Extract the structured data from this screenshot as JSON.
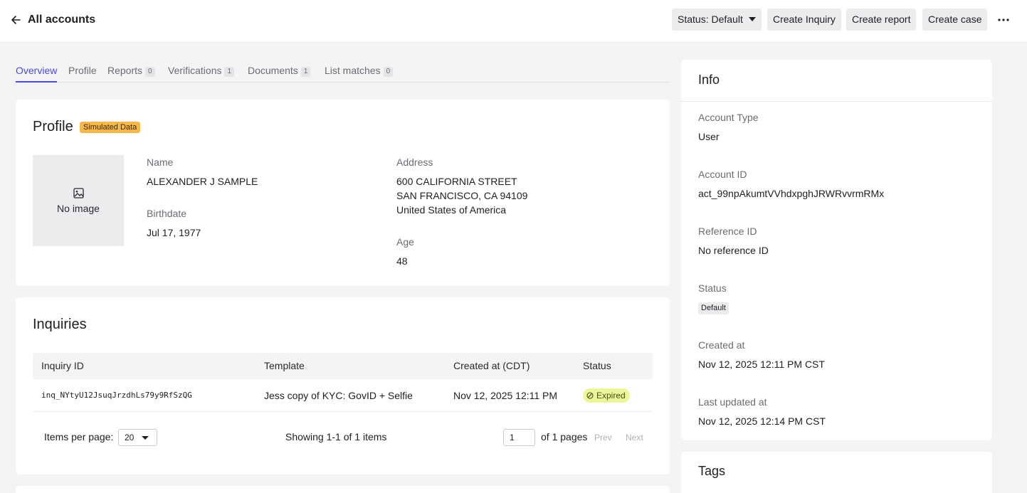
{
  "header": {
    "title": "All accounts",
    "status_button": "Status: Default",
    "create_inquiry": "Create Inquiry",
    "create_report": "Create report",
    "create_case": "Create case"
  },
  "tabs": [
    {
      "label": "Overview",
      "count": null,
      "active": true
    },
    {
      "label": "Profile",
      "count": null
    },
    {
      "label": "Reports",
      "count": "0"
    },
    {
      "label": "Verifications",
      "count": "1"
    },
    {
      "label": "Documents",
      "count": "1"
    },
    {
      "label": "List matches",
      "count": "0"
    }
  ],
  "profile": {
    "title": "Profile",
    "badge": "Simulated Data",
    "no_image": "No image",
    "name_label": "Name",
    "name": "ALEXANDER J SAMPLE",
    "birthdate_label": "Birthdate",
    "birthdate": "Jul 17, 1977",
    "address_label": "Address",
    "address_line1": "600 CALIFORNIA STREET",
    "address_line2": "SAN FRANCISCO, CA 94109",
    "address_line3": "United States of America",
    "age_label": "Age",
    "age": "48"
  },
  "inquiries": {
    "title": "Inquiries",
    "columns": [
      "Inquiry ID",
      "Template",
      "Created at (CDT)",
      "Status"
    ],
    "rows": [
      {
        "id": "inq_NYtyU12JsuqJrzdhLs79y9RfSzQG",
        "template": "Jess copy of KYC: GovID + Selfie",
        "created": "Nov 12, 2025 12:11 PM",
        "status": "Expired"
      }
    ],
    "items_per_page_label": "Items per page:",
    "items_per_page": "20",
    "showing": "Showing 1-1 of 1 items",
    "page": "1",
    "of_pages": "of 1 pages",
    "prev": "Prev",
    "next": "Next"
  },
  "info": {
    "title": "Info",
    "account_type_label": "Account Type",
    "account_type": "User",
    "account_id_label": "Account ID",
    "account_id": "act_99npAkumtVVhdxpghJRWRvvrmRMx",
    "reference_id_label": "Reference ID",
    "reference_id": "No reference ID",
    "status_label": "Status",
    "status": "Default",
    "created_label": "Created at",
    "created": "Nov 12, 2025 12:11 PM CST",
    "updated_label": "Last updated at",
    "updated": "Nov 12, 2025 12:14 PM CST"
  },
  "tags": {
    "title": "Tags"
  },
  "colors": {
    "accent": "#4a4ae0",
    "simulated_badge": "#f6b84b",
    "expired_badge": "#ecf59a"
  }
}
